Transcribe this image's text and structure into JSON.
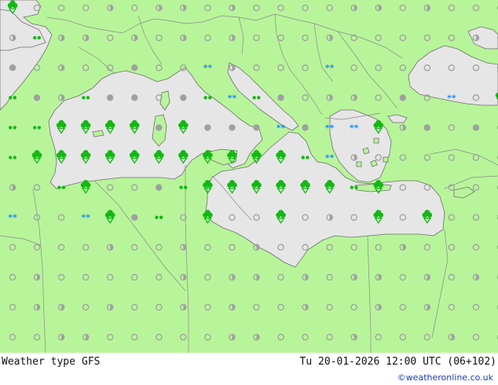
{
  "footer": {
    "title": "Weather type",
    "model": "GFS",
    "valid_time": "Tu 20-01-2026 12:00 UTC (06+102)",
    "credit": "©weatheronline.co.uk"
  },
  "colors": {
    "land": "#b8f59a",
    "sea": "#e6e6e6",
    "border": "#8a8a8a",
    "coast": "#6e6e6e",
    "dot": "#a0a0a0",
    "precip": "#14b814",
    "snow": "#1e8cf0"
  },
  "legend_icons": [
    "grey-dot-no-weather",
    "half-cloud-dot",
    "cloudy-dot",
    "drizzle-dots",
    "rain-cloud",
    "shower-cloud",
    "snow-flakes"
  ],
  "grid": {
    "lons": [
      0,
      1,
      2,
      3,
      4,
      5,
      6,
      7,
      8,
      9,
      10,
      11,
      12,
      13,
      14,
      15,
      16,
      17,
      18,
      19,
      20
    ],
    "lats": [
      0,
      1,
      2,
      3,
      4,
      5,
      6,
      7,
      8,
      9,
      10,
      11
    ],
    "symbols": [
      "R,d,d,d,h,d,h,h,d,h,d,d,d,d,h,h,d,h,d,d,h",
      "h,z,h,h,d,h,d,h,d,h,d,d,d,h,d,d,d,d,d,h,d",
      "c,d,h,d,d,c,d,d,S,h,d,d,d,S,d,d,d,d,d,d,h",
      "z,c,h,z,c,c,d,c,z,S,z,c,d,h,h,d,c,d,S,d,R",
      "z,z,R,R,R,R,c,R,c,c,c,S,c,S,S,R,h,c,d,c,h",
      "z,R,R,R,R,R,R,R,R,R,R,R,z,S,h,d,d,d,d,d,d",
      "h,d,z,R,d,d,c,z,R,R,R,R,R,R,z,R,d,d,d,d,d",
      "S,d,d,S,R,c,z,d,R,d,d,R,d,h,d,R,d,R,d,d,d",
      "d,d,d,d,h,d,d,h,d,d,h,d,d,d,d,d,h,d,d,d,d",
      "d,h,d,d,d,d,d,h,d,h,h,d,h,d,h,h,d,h,d,h,d",
      "d,h,h,d,h,d,d,h,d,h,d,d,h,d,d,h,d,h,d,d,d",
      "d,d,h,h,d,d,d,d,d,h,h,d,d,d,h,d,d,d,h,d,d"
    ]
  }
}
